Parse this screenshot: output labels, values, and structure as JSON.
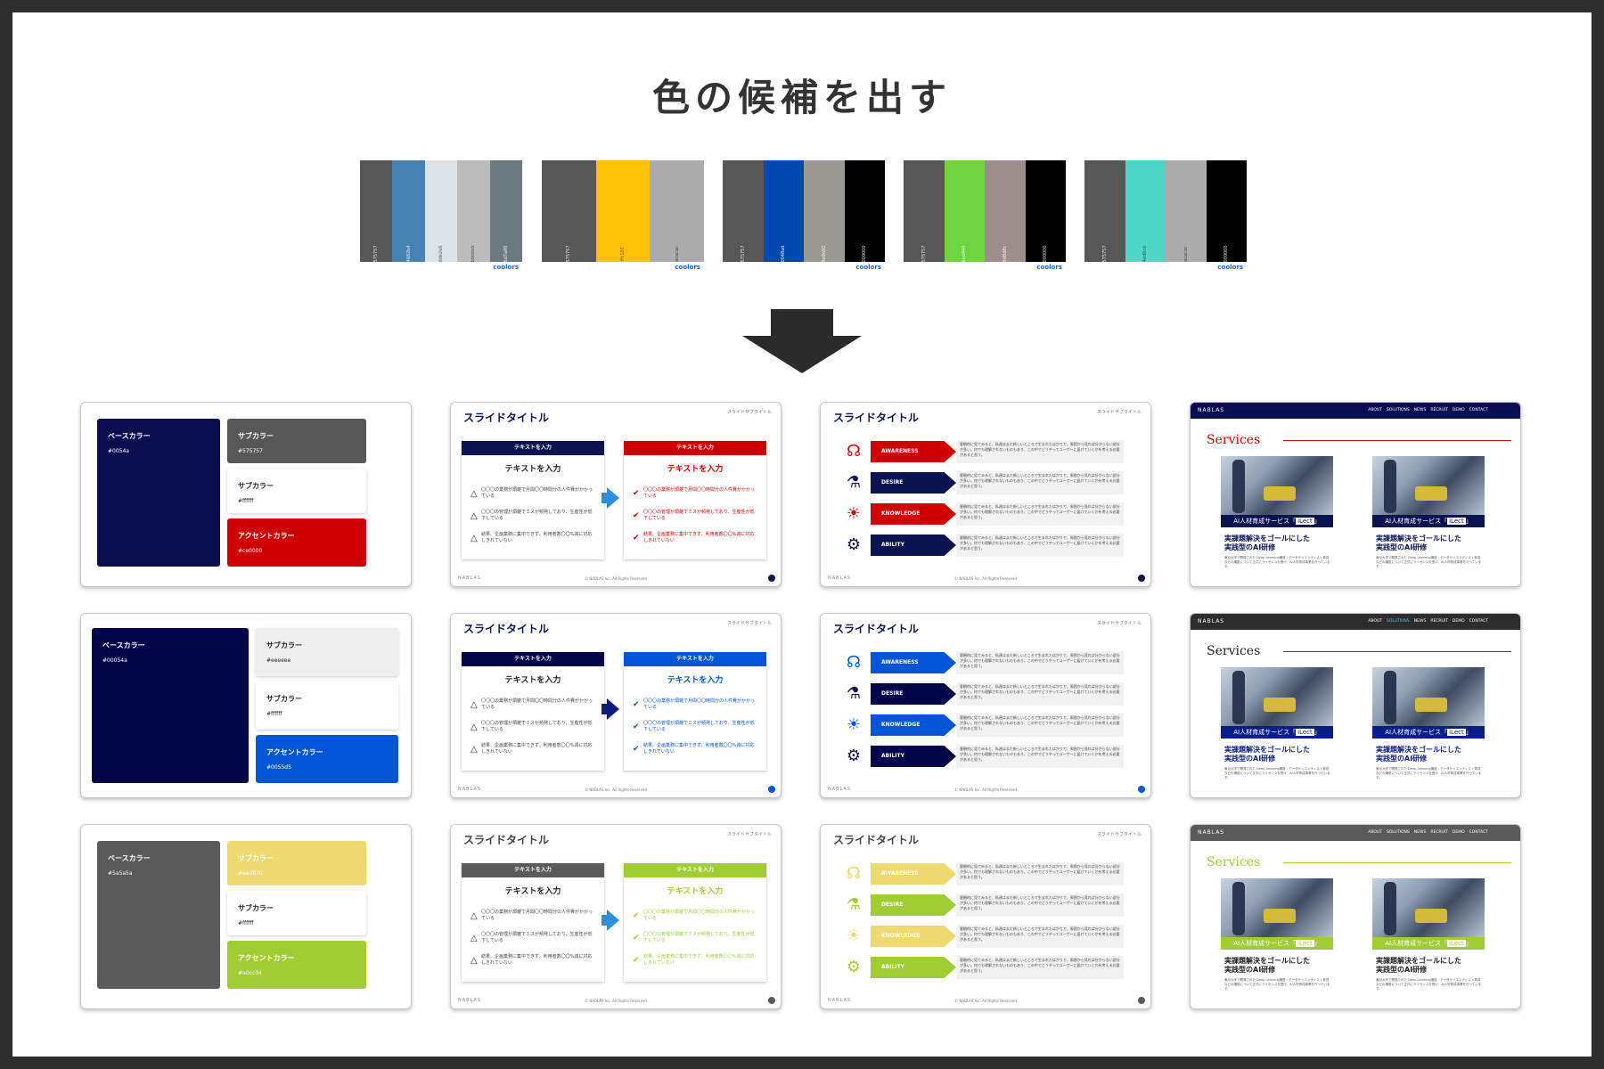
{
  "title": "色の候補を出す",
  "palettes": [
    {
      "colors": [
        "#575757",
        "#4682b4",
        "#dde2e6",
        "#bbbbbb",
        "#6d7a80"
      ],
      "logo": "coolors"
    },
    {
      "colors": [
        "#575757",
        "#ffc107",
        "#acacac"
      ],
      "logo": "coolors"
    },
    {
      "colors": [
        "#575757",
        "#0048ad",
        "#9a9a92",
        "#000000"
      ],
      "logo": "coolors"
    },
    {
      "colors": [
        "#575757",
        "#6ed440",
        "#9d8d8c",
        "#000000"
      ],
      "logo": "coolors"
    },
    {
      "colors": [
        "#575757",
        "#4ed6c6",
        "#acacac",
        "#000000"
      ],
      "logo": "coolors"
    }
  ],
  "swatch_rows": [
    {
      "base": {
        "label": "ベースカラー",
        "value": "#0054a",
        "color": "#0a0e50",
        "text_color": "#ffffff"
      },
      "sub1": {
        "label": "サブカラー",
        "value": "#575757",
        "color": "#575757",
        "text_color": "#ffffff"
      },
      "sub2": {
        "label": "サブカラー",
        "value": "#ffffff",
        "color": "#ffffff",
        "text_color": "#222222"
      },
      "accent": {
        "label": "アクセントカラー",
        "value": "#ce0000",
        "color": "#ce0000",
        "text_color": "#ffffff"
      }
    },
    {
      "base": {
        "label": "ベースカラー",
        "value": "#00054a",
        "color": "#00054a",
        "text_color": "#ffffff"
      },
      "sub1": {
        "label": "サブカラー",
        "value": "#eeeeee",
        "color": "#eeeeee",
        "text_color": "#222222"
      },
      "sub2": {
        "label": "サブカラー",
        "value": "#ffffff",
        "color": "#ffffff",
        "text_color": "#222222"
      },
      "accent": {
        "label": "アクセントカラー",
        "value": "#0055d5",
        "color": "#0055d5",
        "text_color": "#ffffff"
      }
    },
    {
      "base": {
        "label": "ベースカラー",
        "value": "#5a5a5a",
        "color": "#5a5a5a",
        "text_color": "#ffffff"
      },
      "sub1": {
        "label": "サブカラー",
        "value": "#eed870",
        "color": "#eed870",
        "text_color": "#ffffff"
      },
      "sub2": {
        "label": "サブカラー",
        "value": "#ffffff",
        "color": "#ffffff",
        "text_color": "#222222"
      },
      "accent": {
        "label": "アクセントカラー",
        "value": "#a0cc34",
        "color": "#a0cc34",
        "text_color": "#ffffff"
      }
    }
  ],
  "slide": {
    "title": "スライドタイトル",
    "subtitle": "スライドサブタイトル",
    "logo": "NABLAS",
    "copyright": "© NABLAS Inc. All Rights Reserved",
    "box_head": "テキストを入力",
    "box_sub": "テキストを入力",
    "rows": [
      "〇〇〇の業務が煩雑で月間〇〇時間分の人件費がかかっている",
      "〇〇〇の管理が煩雑でミスが頻発しており、生産性が低下している",
      "結果、企画業務に集中できず、利用者数〇〇%減に対応しきれていない"
    ]
  },
  "aidma": {
    "steps": [
      "AWARENESS",
      "DESIRE",
      "KNOWLEDGE",
      "ABILITY"
    ],
    "icons": [
      "brain-icon",
      "microscope-icon",
      "lightbulb-icon",
      "gear-icon"
    ],
    "desc": "客観的に見てみると、私達はまだ新しいところで生まれたばかりで、周囲から見れば分からない部分が多い。何でも理解されないものもあり、この中でどうやってユーザーに届けていくかを考える必要があると思う。"
  },
  "slide_themes": [
    {
      "left_head": "#0a1450",
      "right_head": "#ce0000",
      "arrow": "#2e8fe0",
      "left_icon": "△",
      "right_icon": "●",
      "right_text": "#ce0000",
      "right_sub": "#ce0000",
      "step_colors": [
        "#ce0000",
        "#0a1450",
        "#ce0000",
        "#0a1450"
      ],
      "icon_color": "#ce0000",
      "dot": "#0a1450"
    },
    {
      "left_head": "#00054a",
      "right_head": "#0055d5",
      "arrow": "#0a1e7a",
      "left_icon": "△",
      "right_icon": "●",
      "right_text": "#0055d5",
      "right_sub": "#0055d5",
      "step_colors": [
        "#0055d5",
        "#00054a",
        "#0055d5",
        "#00054a"
      ],
      "icon_color": "#0055d5",
      "dot": "#0055d5"
    },
    {
      "left_head": "#5a5a5a",
      "right_head": "#a0cc34",
      "arrow": "#2e8fe0",
      "left_icon": "△",
      "right_icon": "●",
      "right_text": "#a0cc34",
      "right_sub": "#a0cc34",
      "step_colors": [
        "#eed870",
        "#a0cc34",
        "#eed870",
        "#a0cc34"
      ],
      "icon_color": "#c8c030",
      "dot": "#5a5a5a"
    }
  ],
  "web": {
    "brand": "NABLAS",
    "nav": [
      "ABOUT",
      "SOLUTIONS",
      "NEWS",
      "RECRUIT",
      "DEMO",
      "CONTACT"
    ],
    "heading": "Services",
    "band_prefix": "AI人材育成サービス「",
    "band_name": "iLect",
    "band_suffix": "」",
    "card_title_1": "実課題解決をゴールにした",
    "card_title_2": "実践型のAI研修",
    "card_desc": "東京大学で開発された Deep Learning講座・データサイエンティスト育成などの講座について正式にライセンスを受け、AI人材育成事業を行っています。"
  },
  "web_themes": [
    {
      "nav": "#0a0e50",
      "heading": "#ce0000",
      "line": "#ce0000",
      "band": "#0a1450",
      "title": "#0a1450"
    },
    {
      "nav": "#2d2d2d",
      "heading": "#222222",
      "line": "#444444",
      "band": "#0a1e8a",
      "title": "#0a1e8a"
    },
    {
      "nav": "#5a5a5a",
      "heading": "#a0cc34",
      "line": "#a0cc34",
      "band": "#a0cc34",
      "title": "#222222"
    }
  ]
}
